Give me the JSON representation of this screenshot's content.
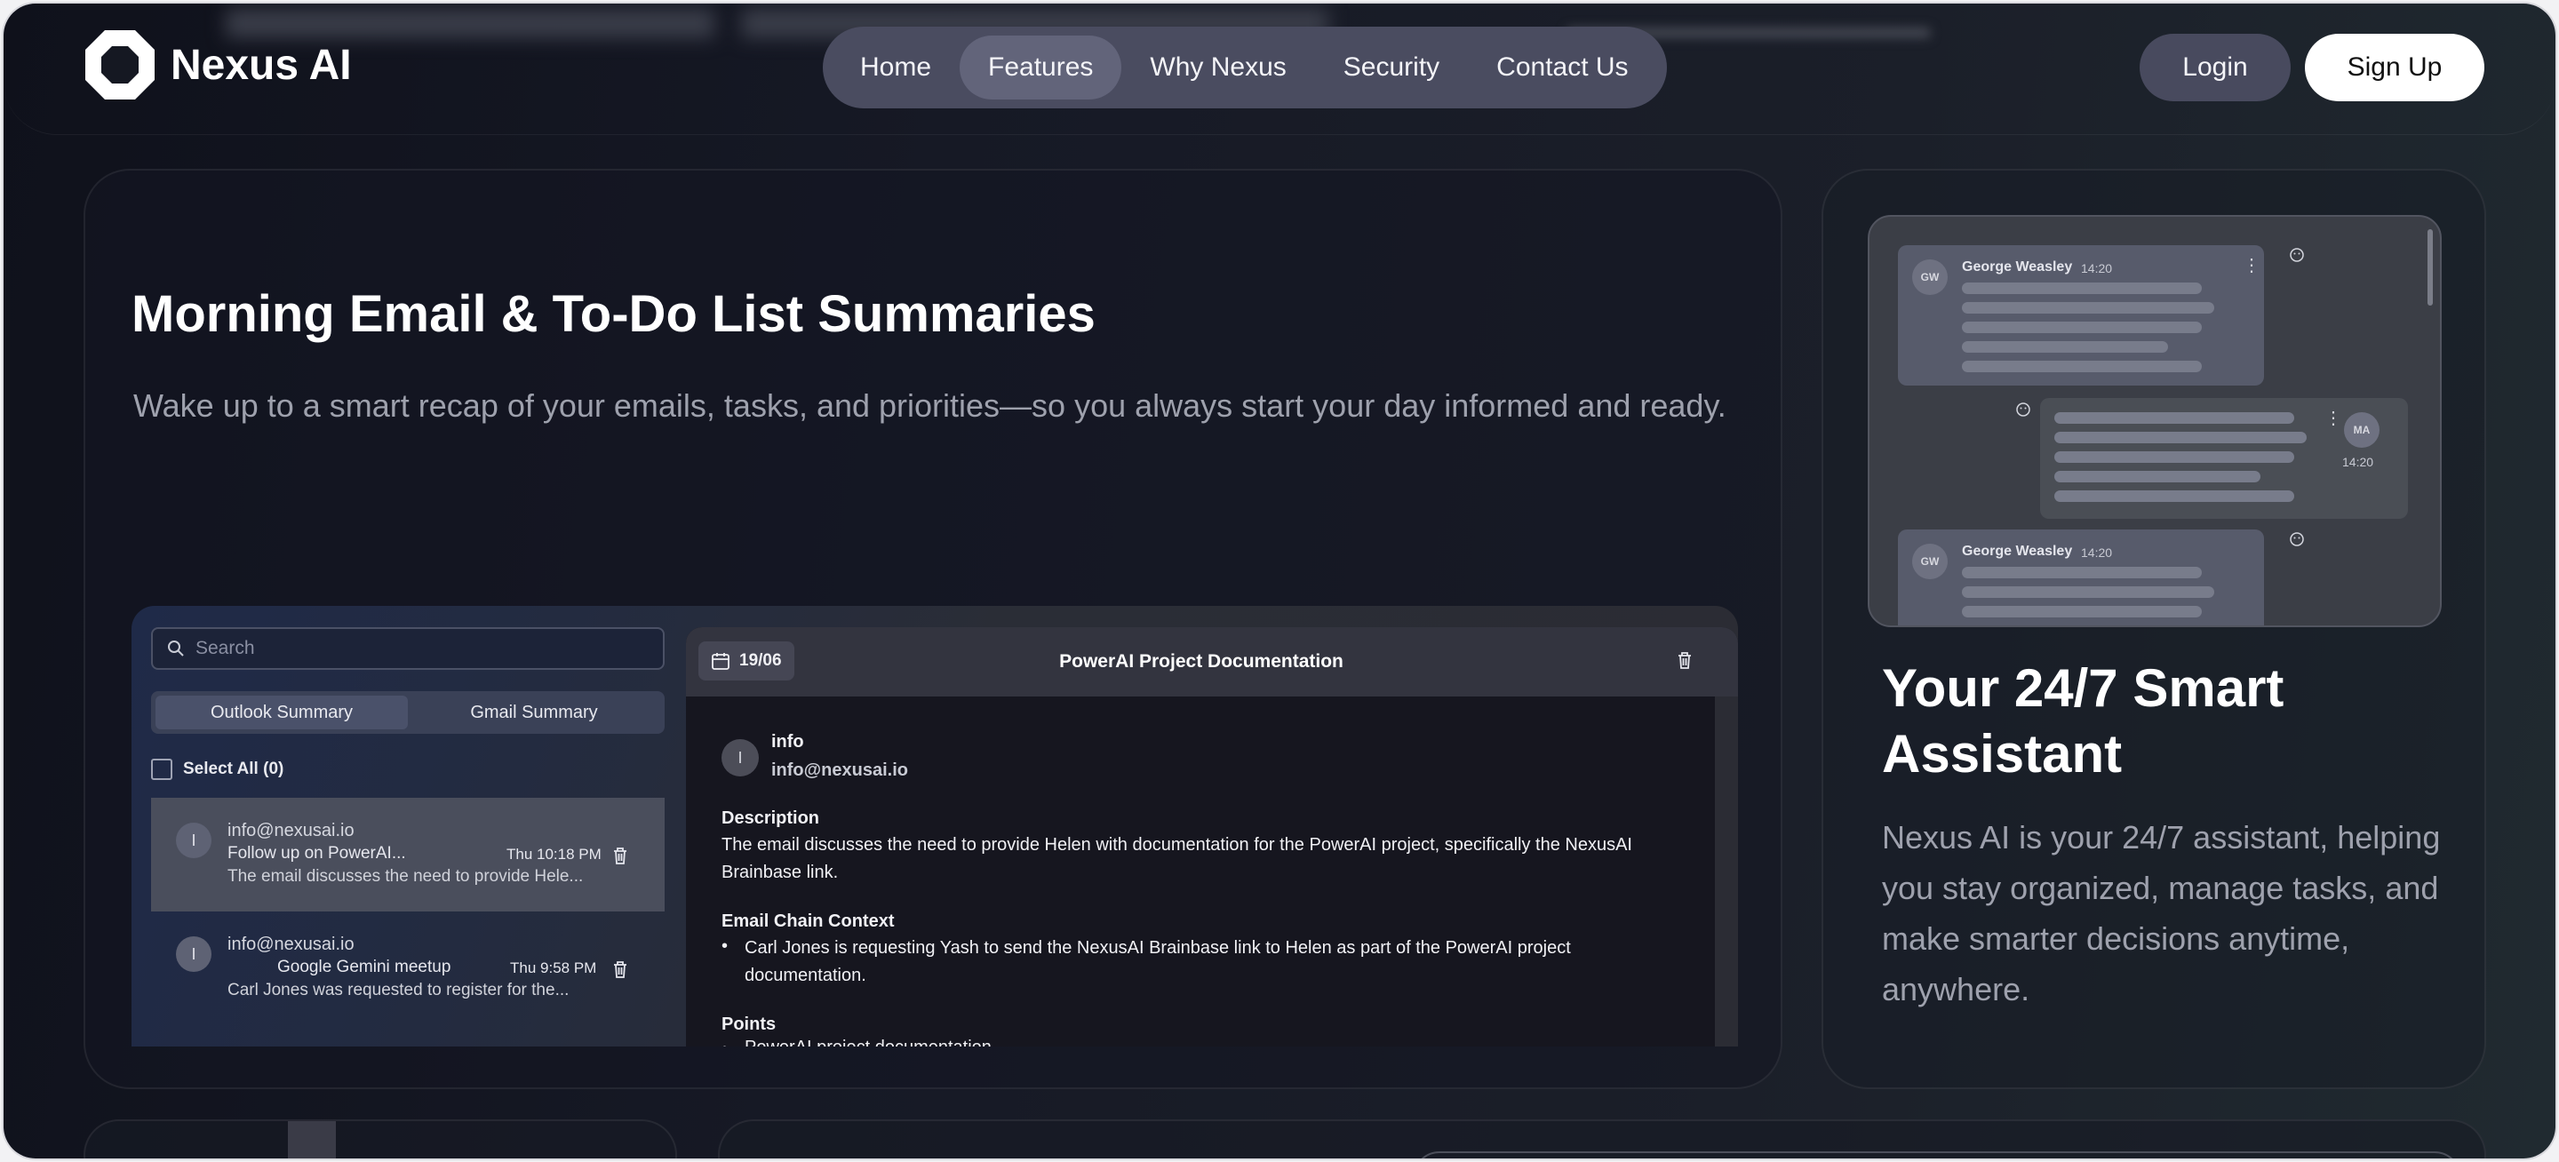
{
  "brand": {
    "name": "Nexus AI"
  },
  "nav": {
    "items": [
      "Home",
      "Features",
      "Why Nexus",
      "Security",
      "Contact Us"
    ],
    "active": "Features"
  },
  "auth": {
    "login": "Login",
    "signup": "Sign Up"
  },
  "feature_main": {
    "title": "Morning Email & To-Do List Summaries",
    "subtitle": "Wake up to a smart recap of your emails, tasks, and priorities—so you always start your day informed and ready."
  },
  "email_app": {
    "search_placeholder": "Search",
    "tabs": [
      "Outlook Summary",
      "Gmail Summary"
    ],
    "select_all": "Select All (0)",
    "list": [
      {
        "avatar": "I",
        "from": "info@nexusai.io",
        "subject": "Follow up on PowerAI...",
        "preview": "The email discusses the need to provide Hele...",
        "time": "Thu 10:18 PM"
      },
      {
        "avatar": "I",
        "from": "info@nexusai.io",
        "subject": "Google Gemini meetup",
        "preview": "Carl Jones was requested to register for the...",
        "time": "Thu 9:58 PM"
      }
    ],
    "detail": {
      "date": "19/06",
      "title": "PowerAI Project Documentation",
      "sender_avatar": "I",
      "sender_name": "info",
      "sender_email": "info@nexusai.io",
      "description_heading": "Description",
      "description": "The email discusses the need to provide Helen with documentation for the PowerAI project, specifically the NexusAI Brainbase link.",
      "context_heading": "Email Chain Context",
      "context_bullets": [
        "Carl Jones is requesting Yash to send the NexusAI Brainbase link to Helen as part of the PowerAI project documentation."
      ],
      "points_heading": "Points",
      "points_bullets": [
        "PowerAI project documentation"
      ]
    }
  },
  "feature_side": {
    "chat": {
      "messages": [
        {
          "avatar": "GW",
          "name": "George Weasley",
          "time": "14:20"
        },
        {
          "avatar": "MA",
          "time": "14:20"
        },
        {
          "avatar": "GW",
          "name": "George Weasley",
          "time": "14:20"
        }
      ]
    },
    "title": "Your 24/7 Smart Assistant",
    "subtitle": "Nexus AI is your 24/7 assistant, helping you stay organized, manage tasks, and make smarter decisions anytime, anywhere."
  }
}
